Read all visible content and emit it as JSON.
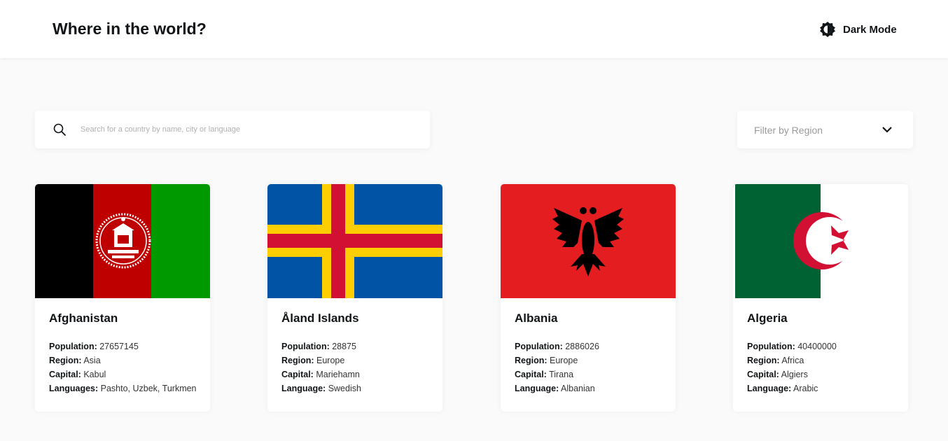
{
  "header": {
    "title": "Where in the world?",
    "dark_mode_label": "Dark Mode",
    "dark_mode_icon": "contrast-icon"
  },
  "search": {
    "placeholder": "Search for a country by name, city or language",
    "value": "",
    "icon": "search-icon"
  },
  "filter": {
    "label": "Filter by Region",
    "icon": "chevron-down-icon"
  },
  "countries": [
    {
      "name": "Afghanistan",
      "facts": [
        {
          "label": "Population:",
          "value": "27657145"
        },
        {
          "label": "Region:",
          "value": "Asia"
        },
        {
          "label": "Capital:",
          "value": "Kabul"
        },
        {
          "label": "Languages:",
          "value": "Pashto, Uzbek, Turkmen"
        }
      ]
    },
    {
      "name": "Åland Islands",
      "facts": [
        {
          "label": "Population:",
          "value": "28875"
        },
        {
          "label": "Region:",
          "value": "Europe"
        },
        {
          "label": "Capital:",
          "value": "Mariehamn"
        },
        {
          "label": "Language:",
          "value": "Swedish"
        }
      ]
    },
    {
      "name": "Albania",
      "facts": [
        {
          "label": "Population:",
          "value": "2886026"
        },
        {
          "label": "Region:",
          "value": "Europe"
        },
        {
          "label": "Capital:",
          "value": "Tirana"
        },
        {
          "label": "Language:",
          "value": "Albanian"
        }
      ]
    },
    {
      "name": "Algeria",
      "facts": [
        {
          "label": "Population:",
          "value": "40400000"
        },
        {
          "label": "Region:",
          "value": "Africa"
        },
        {
          "label": "Capital:",
          "value": "Algiers"
        },
        {
          "label": "Language:",
          "value": "Arabic"
        }
      ]
    }
  ],
  "colors": {
    "background": "#fafafa",
    "card": "#ffffff",
    "text": "#111517"
  }
}
